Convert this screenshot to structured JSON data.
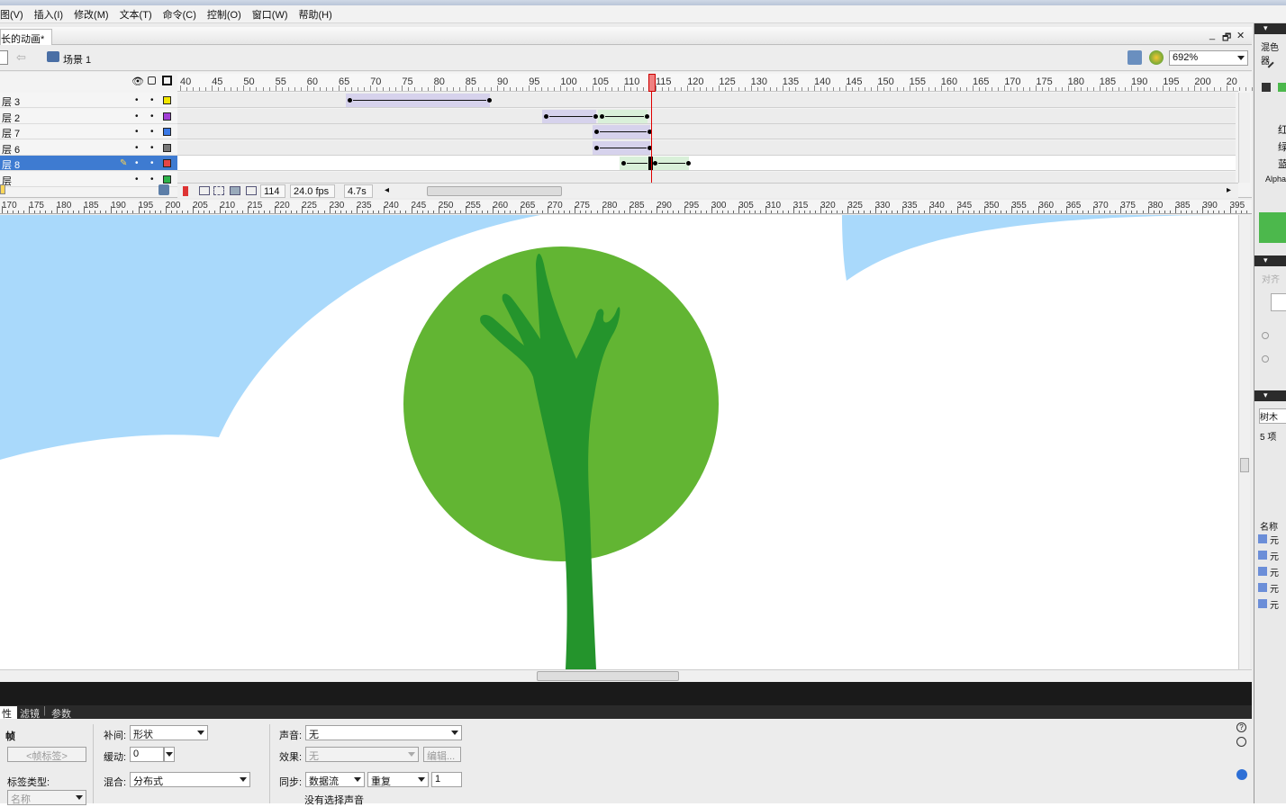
{
  "menu": [
    "图(V)",
    "插入(I)",
    "修改(M)",
    "文本(T)",
    "命令(C)",
    "控制(O)",
    "窗口(W)",
    "帮助(H)"
  ],
  "document": {
    "tab_title": "长的动画*",
    "scene_label": "场景 1",
    "zoom": "692%"
  },
  "window_buttons": [
    "_",
    "🗗",
    "✕"
  ],
  "timeline": {
    "frame_labels": [
      "40",
      "45",
      "50",
      "55",
      "60",
      "65",
      "70",
      "75",
      "80",
      "85",
      "90",
      "95",
      "100",
      "105",
      "110",
      "115",
      "120",
      "125",
      "130",
      "135",
      "140",
      "145",
      "150",
      "155",
      "160",
      "165",
      "170",
      "175",
      "180",
      "185",
      "190",
      "195",
      "200",
      "20"
    ],
    "layers": [
      {
        "name": "层 3",
        "color": "#f2e600",
        "selected": false
      },
      {
        "name": "层 2",
        "color": "#a23fd6",
        "selected": false
      },
      {
        "name": "层 7",
        "color": "#3a79e6",
        "selected": false
      },
      {
        "name": "层 6",
        "color": "#777777",
        "selected": false
      },
      {
        "name": "层 8",
        "color": "#e64545",
        "selected": true
      },
      {
        "name": "层",
        "color": "#2db34a",
        "selected": false
      }
    ],
    "current_frame": "114",
    "fps": "24.0 fps",
    "elapsed": "4.7s"
  },
  "pixel_ruler_labels": [
    "170",
    "175",
    "180",
    "185",
    "190",
    "195",
    "200",
    "205",
    "210",
    "215",
    "220",
    "225",
    "230",
    "235",
    "240",
    "245",
    "250",
    "255",
    "260",
    "265",
    "270",
    "275",
    "280",
    "285",
    "290",
    "295",
    "300",
    "305",
    "310",
    "315",
    "320",
    "325",
    "330",
    "335",
    "340",
    "345",
    "350",
    "355",
    "360",
    "365",
    "370",
    "375",
    "380",
    "385",
    "390",
    "395"
  ],
  "stage": {
    "sky_color": "#a9d9fb",
    "cloud_color": "#ffffff",
    "foliage_color": "#62b533",
    "trunk_color": "#24942c"
  },
  "properties": {
    "tabs": [
      "性",
      "滤镜",
      "参数"
    ],
    "frame_label": "帧",
    "frame_name_placeholder": "<帧标签>",
    "label_type_caption": "标签类型:",
    "label_type_value": "名称",
    "tween_caption": "补间:",
    "tween_value": "形状",
    "ease_caption": "缓动:",
    "ease_value": "0",
    "blend_caption": "混合:",
    "blend_value": "分布式",
    "sound_caption": "声音:",
    "sound_value": "无",
    "effect_caption": "效果:",
    "effect_value": "无",
    "edit_button": "编辑...",
    "sync_caption": "同步:",
    "sync_value": "数据流",
    "repeat_value": "重复",
    "repeat_count": "1",
    "no_sound": "没有选择声音"
  },
  "right_panel": {
    "color_mixer_title": "混色器",
    "red": "红",
    "green": "绿",
    "blue": "蓝",
    "alpha": "Alpha",
    "align_title": "对齐",
    "library_item": "树木原",
    "item_count": "5 项",
    "name_header": "名称",
    "items": [
      "元",
      "元",
      "元",
      "元",
      "元"
    ],
    "swatch_color": "#4cb84c"
  }
}
